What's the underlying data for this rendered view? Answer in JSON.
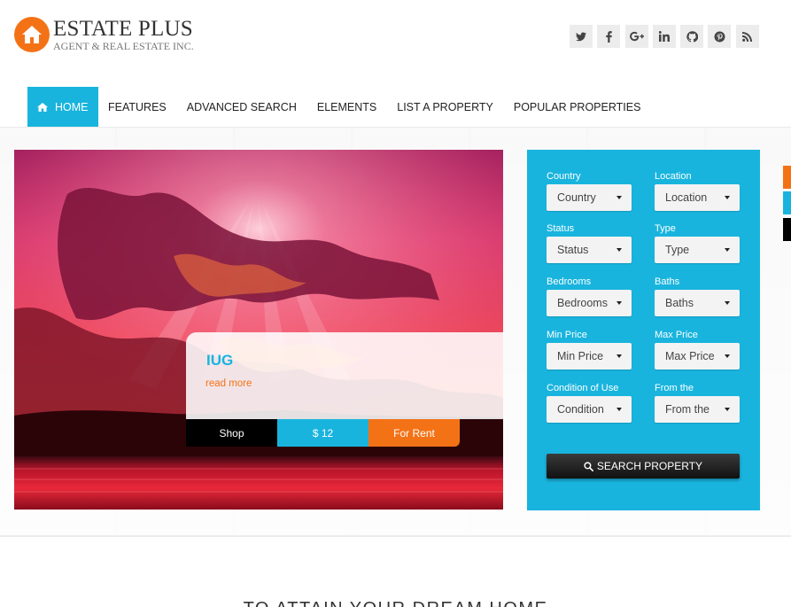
{
  "brand": {
    "title": "ESTATE PLUS",
    "subtitle": "AGENT & REAL ESTATE INC.",
    "icon": "house-icon",
    "accent": "#f47216"
  },
  "social": [
    {
      "name": "twitter-icon",
      "glyph": "t"
    },
    {
      "name": "facebook-icon",
      "glyph": "f"
    },
    {
      "name": "google-plus-icon",
      "glyph": "g+"
    },
    {
      "name": "linkedin-icon",
      "glyph": "in"
    },
    {
      "name": "github-icon",
      "glyph": "gh"
    },
    {
      "name": "pinterest-icon",
      "glyph": "p"
    },
    {
      "name": "rss-icon",
      "glyph": "rss"
    }
  ],
  "nav": {
    "home": "HOME",
    "features": "FEATURES",
    "advanced_search": "ADVANCED SEARCH",
    "elements": "ELEMENTS",
    "list_property": "LIST A PROPERTY",
    "popular": "POPULAR PROPERTIES"
  },
  "slide": {
    "title": "IUG",
    "link": "read more",
    "tags": {
      "category": "Shop",
      "price": "$ 12",
      "status": "For Rent"
    }
  },
  "search": {
    "country": {
      "label": "Country",
      "value": "Country"
    },
    "location": {
      "label": "Location",
      "value": "Location"
    },
    "status": {
      "label": "Status",
      "value": "Status"
    },
    "type": {
      "label": "Type",
      "value": "Type"
    },
    "bedrooms": {
      "label": "Bedrooms",
      "value": "Bedrooms"
    },
    "baths": {
      "label": "Baths",
      "value": "Baths"
    },
    "min_price": {
      "label": "Min Price",
      "value": "Min Price"
    },
    "max_price": {
      "label": "Max Price",
      "value": "Max Price"
    },
    "condition": {
      "label": "Condition of Use",
      "value": "Condition"
    },
    "from": {
      "label": "From the",
      "value": "From the"
    },
    "button": "SEARCH PROPERTY"
  },
  "section": {
    "heading": "TO ATTAIN YOUR DREAM HOME"
  },
  "colors": {
    "primary": "#19b4de",
    "accent": "#f47216",
    "dark": "#000000"
  }
}
